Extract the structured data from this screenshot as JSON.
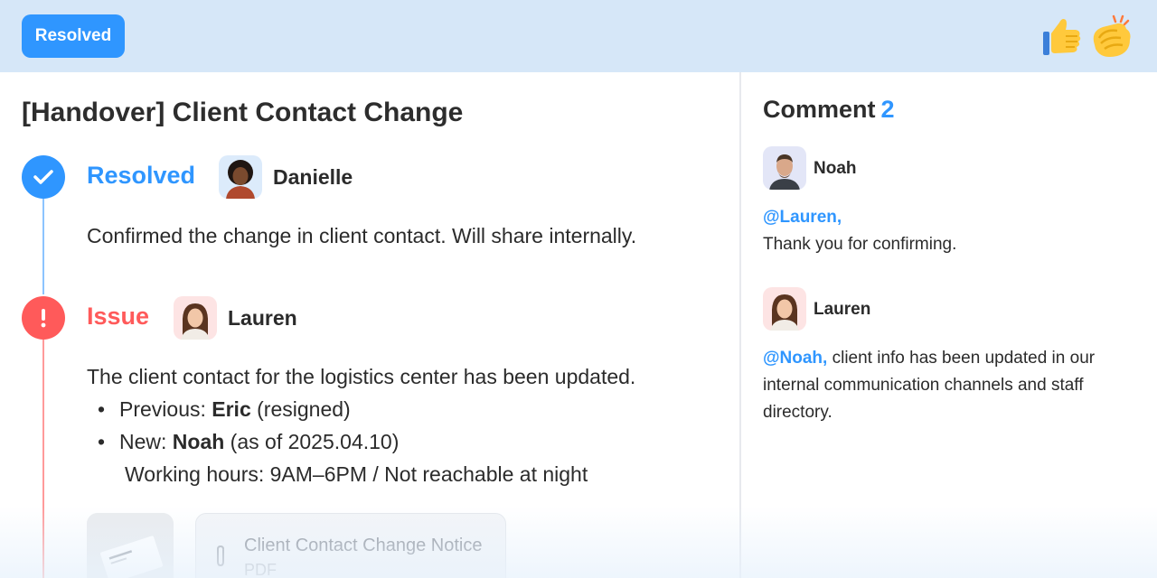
{
  "header": {
    "status_badge": "Resolved",
    "reactions": [
      {
        "name": "thumbs-up",
        "icon": "thumbs-up-icon"
      },
      {
        "name": "clapping-hands",
        "icon": "clapping-hands-icon"
      }
    ]
  },
  "ticket": {
    "title": "[Handover] Client Contact Change",
    "timeline": [
      {
        "status": "Resolved",
        "status_color": "#2f96ff",
        "icon": "check-icon",
        "author": "Danielle",
        "text": "Confirmed the change in client contact. Will share internally."
      },
      {
        "status": "Issue",
        "status_color": "#ff5a5a",
        "icon": "exclamation-icon",
        "author": "Lauren",
        "text": "The client contact for the logistics center has been updated.",
        "bullets": [
          {
            "bullet": "•",
            "label": "Previous: ",
            "bold": "Eric",
            "rest": " (resigned)"
          },
          {
            "bullet": "•",
            "label": "New: ",
            "bold": "Noah",
            "rest": " (as of 2025.04.10)"
          }
        ],
        "extra_line": "Working hours: 9AM–6PM / Not reachable at night",
        "attachment": {
          "name": "Client Contact Change Notice",
          "type": "PDF"
        }
      }
    ]
  },
  "comments": {
    "label": "Comment",
    "count": "2",
    "items": [
      {
        "author": "Noah",
        "mention": "@Lauren,",
        "text": "Thank you for confirming."
      },
      {
        "author": "Lauren",
        "mention": "@Noah,",
        "text": " client info has been updated in our internal communication channels and staff directory."
      }
    ]
  },
  "colors": {
    "accent": "#2f96ff",
    "issue": "#ff5a5a",
    "header_bg": "#d6e7f8"
  }
}
